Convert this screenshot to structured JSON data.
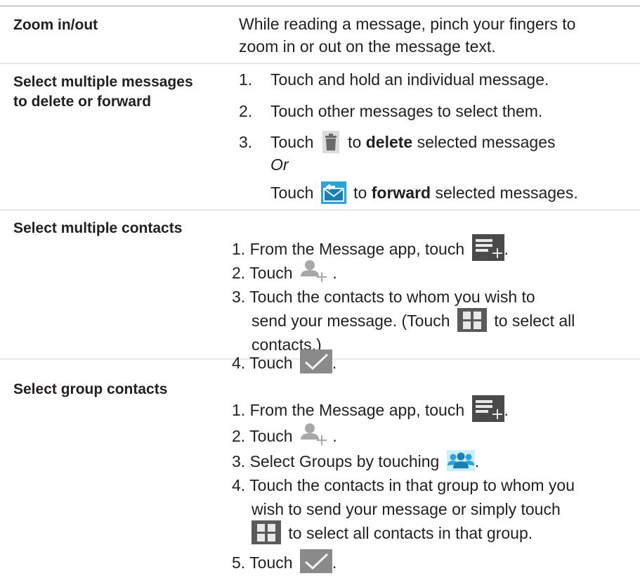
{
  "row_zoom": {
    "label": "Zoom in/out",
    "line1": "While reading a message, pinch your fingers to",
    "line2": "zoom in or out on the message text."
  },
  "row_select_messages": {
    "label_line1": "Select multiple messages",
    "label_line2": "to delete or forward",
    "step1_num": "1.",
    "step1": "Touch and hold an individual message.",
    "step2_num": "2.",
    "step2": "Touch other messages to select them.",
    "step3_num": "3.",
    "step3_pre": "Touch",
    "step3_mid": "to",
    "step3_bold": "delete",
    "step3_post": "selected messages",
    "or": "Or",
    "step3b_pre": "Touch",
    "step3b_mid": "to",
    "step3b_bold": "forward",
    "step3b_post": "selected messages.",
    "icons": [
      "trash-icon",
      "forward-mail-icon"
    ]
  },
  "row_select_contacts": {
    "label": "Select multiple contacts",
    "step1": "1. From the Message app, touch",
    "step2": "2. Touch",
    "step3_line1": "3. Touch the contacts to whom you wish to",
    "step3_line2_pre": "send your message. (Touch",
    "step3_line2_post": "to select all",
    "step3_line3": "contacts.)",
    "step4": "4. Touch",
    "period": ".",
    "icons": [
      "new-message-icon",
      "add-contact-icon",
      "select-all-icon",
      "checkmark-icon"
    ]
  },
  "row_group_contacts": {
    "label": "Select group contacts",
    "step1": "1. From the Message app, touch",
    "step2": "2. Touch",
    "step3": "3. Select Groups by touching",
    "step4_line1": "4. Touch the contacts in that group to whom you",
    "step4_line2": "wish to send your message or simply touch",
    "step4_line3": "to select all contacts in that group.",
    "step5": "5. Touch",
    "period": ".",
    "icons": [
      "new-message-icon",
      "add-contact-icon",
      "groups-icon",
      "select-all-icon",
      "checkmark-icon"
    ]
  },
  "colors": {
    "rule": "#9a9a9a",
    "icon_dark": "#4a4a4a",
    "icon_gray": "#a8a8a8",
    "icon_blue": "#2aa3dc",
    "check_bg": "#8a8a8a"
  }
}
